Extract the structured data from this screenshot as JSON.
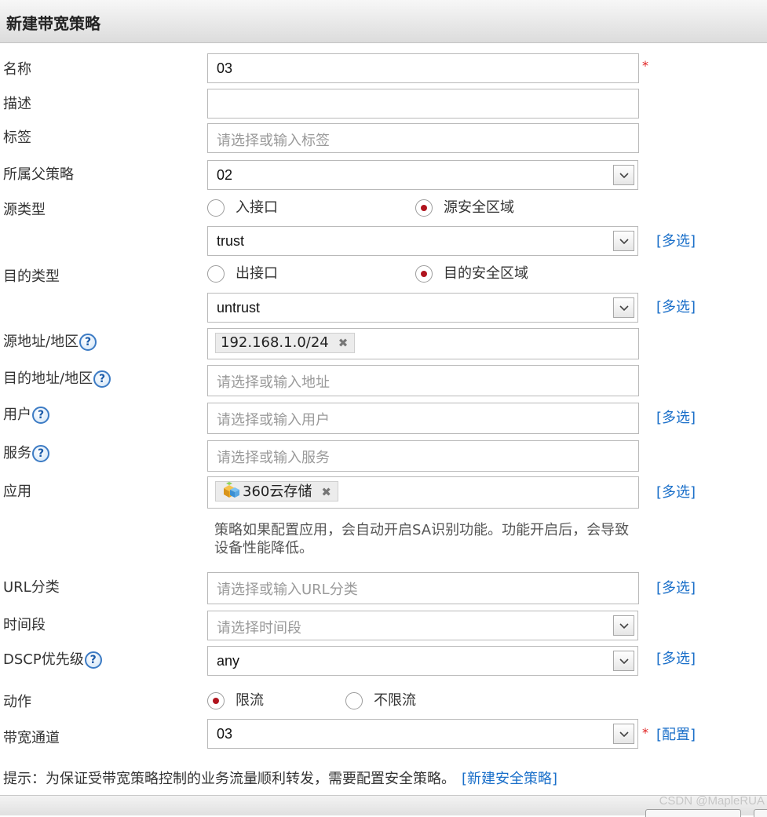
{
  "header": {
    "title": "新建带宽策略"
  },
  "labels": {
    "name": "名称",
    "desc": "描述",
    "tag": "标签",
    "parent": "所属父策略",
    "src_type": "源类型",
    "dst_type": "目的类型",
    "src_addr": "源地址/地区",
    "dst_addr": "目的地址/地区",
    "user": "用户",
    "service": "服务",
    "app": "应用",
    "url": "URL分类",
    "time": "时间段",
    "dscp": "DSCP优先级",
    "action": "动作",
    "channel": "带宽通道"
  },
  "help_icon": {
    "glyph": "?",
    "icon": "question-mark-icon"
  },
  "fields": {
    "name_value": "03",
    "desc_value": "",
    "tag_placeholder": "请选择或输入标签",
    "parent_value": "02",
    "src_zone_value": "trust",
    "dst_zone_value": "untrust",
    "src_addr_tag": "192.168.1.0/24",
    "dst_addr_placeholder": "请选择或输入地址",
    "user_placeholder": "请选择或输入用户",
    "service_placeholder": "请选择或输入服务",
    "app_tag": "360云存储",
    "url_placeholder": "请选择或输入URL分类",
    "time_placeholder": "请选择时间段",
    "dscp_value": "any",
    "channel_value": "03"
  },
  "radios": {
    "src_interface": "入接口",
    "src_zone": "源安全区域",
    "dst_interface": "出接口",
    "dst_zone": "目的安全区域",
    "action_limit": "限流",
    "action_nolimit": "不限流"
  },
  "links": {
    "multi_select": "[多选]",
    "config": "[配置]",
    "new_security_policy": "[新建安全策略]"
  },
  "required_mark": "*",
  "tag_remove": "✖",
  "app_hint": "策略如果配置应用，会自动开启SA识别功能。功能开启后，会导致设备性能降低。",
  "tip_text": "提示：为保证受带宽策略控制的业务流量顺利转发，需要配置安全策略。",
  "watermark": "CSDN @MapleRUA",
  "colors": {
    "link": "#1a6fc9",
    "required": "#e02020",
    "radio_selected": "#b0141e"
  }
}
